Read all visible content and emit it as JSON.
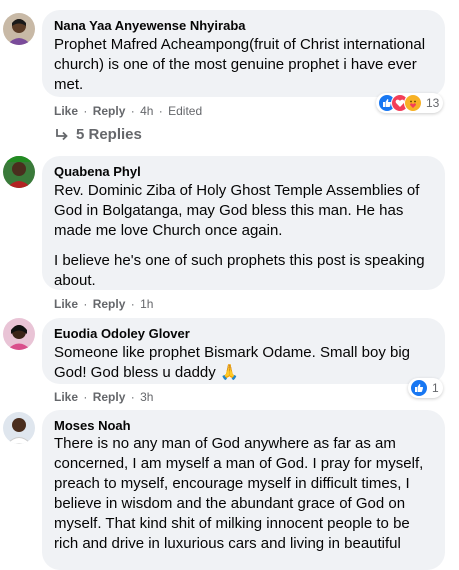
{
  "actions": {
    "like": "Like",
    "reply": "Reply",
    "dot": "·"
  },
  "comments": [
    {
      "author": "Nana Yaa Anyewense Nhyiraba",
      "paragraphs": [
        "Prophet Mafred Acheampong(fruit of Christ international church) is one of the most genuine prophet i have ever met."
      ],
      "time": "4h",
      "edited": "Edited",
      "reactions": {
        "icons": [
          "like",
          "love",
          "care"
        ],
        "count": "13"
      },
      "replies": "5 Replies"
    },
    {
      "author": "Quabena Phyl",
      "paragraphs": [
        "Rev. Dominic Ziba of Holy Ghost Temple Assemblies of God in Bolgatanga, may God bless this man. He has made me love Church once again.",
        "I believe he's one of such prophets this post is speaking about."
      ],
      "time": "1h"
    },
    {
      "author": "Euodia Odoley Glover",
      "paragraphs": [
        "Someone like prophet Bismark Odame. Small boy big God! God bless u daddy 🙏"
      ],
      "time": "3h",
      "reactions": {
        "icons": [
          "like"
        ],
        "count": "1"
      }
    },
    {
      "author": "Moses Noah",
      "paragraphs": [
        "There is no any man of God anywhere as far as am concerned, I am myself a man of God. I pray for myself, preach to myself, encourage myself in difficult times, I believe in wisdom and the abundant grace of God on myself. That kind shit of milking innocent people to be rich and drive in luxurious cars and living in beautiful"
      ]
    }
  ],
  "colors": {
    "bubble": "#f0f2f5",
    "meta": "#65676b",
    "like": "#1877f2",
    "love": "#f33e58",
    "care": "#f7b125"
  }
}
